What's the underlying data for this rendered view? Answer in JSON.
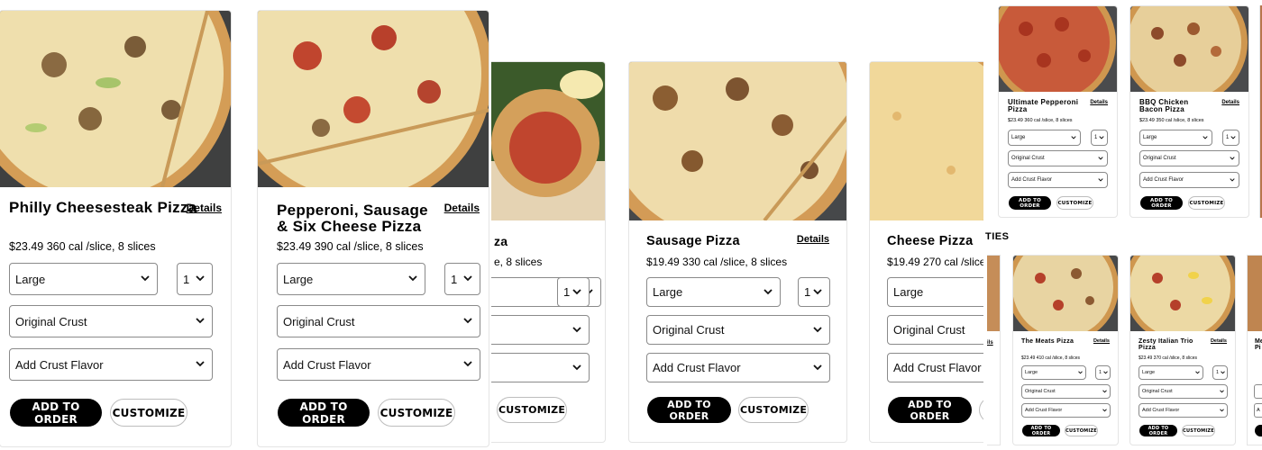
{
  "labels": {
    "details": "Details",
    "add_to_order": "ADD TO ORDER",
    "customize": "CUSTOMIZE"
  },
  "products": {
    "philly": {
      "name": "Philly Cheesesteak Pizza",
      "meta": "$23.49 360 cal /slice, 8 slices",
      "size": "Large",
      "qty": "1",
      "crust": "Original Crust",
      "flavor": "Add Crust Flavor"
    },
    "pss": {
      "name": "Pepperoni, Sausage & Six Cheese Pizza",
      "meta": "$23.49 390 cal /slice, 8 slices",
      "size": "Large",
      "qty": "1",
      "crust": "Original Crust",
      "flavor": "Add Crust Flavor"
    },
    "pep_partial": {
      "name": "za",
      "meta": "e, 8 slices",
      "qty": "1"
    },
    "sausage": {
      "name": "Sausage Pizza",
      "meta": "$19.49 330 cal /slice, 8 slices",
      "size": "Large",
      "qty": "1",
      "crust": "Original Crust",
      "flavor": "Add Crust Flavor"
    },
    "cheese": {
      "name": "Cheese Pizza",
      "meta": "$19.49 270 cal /slice,",
      "size": "Large",
      "crust": "Original Crust",
      "flavor": "Add Crust Flavor"
    },
    "ult_pep": {
      "name": "Ultimate Pepperoni Pizza",
      "meta": "$23.49 360 cal /slice, 8 slices",
      "size": "Large",
      "qty": "1",
      "crust": "Original Crust",
      "flavor": "Add Crust Flavor"
    },
    "bbq": {
      "name": "BBQ Chicken Bacon Pizza",
      "meta": "$23.49 350 cal /slice, 8 slices",
      "size": "Large",
      "qty": "1",
      "crust": "Original Crust",
      "flavor": "Add Crust Flavor"
    },
    "meats": {
      "name": "The Meats Pizza",
      "meta": "$23.49 410 cal /slice, 8 slices",
      "size": "Large",
      "qty": "1",
      "crust": "Original Crust",
      "flavor": "Add Crust Flavor"
    },
    "zesty": {
      "name": "Zesty Italian Trio Pizza",
      "meta": "$23.49 370 cal /slice, 8 slices",
      "size": "Large",
      "qty": "1",
      "crust": "Original Crust",
      "flavor": "Add Crust Flavor"
    },
    "me_partial": {
      "name": "Me\nPi"
    }
  },
  "section_fragment": "TIES",
  "fragments": {
    "details_small": "ils",
    "a_trunc": "A"
  },
  "colors": {
    "cheese": "#f0dca0",
    "crust": "#d8a560",
    "pepperoni": "#c0452e",
    "board": "#4b4b4b",
    "button_dark": "#000000"
  }
}
